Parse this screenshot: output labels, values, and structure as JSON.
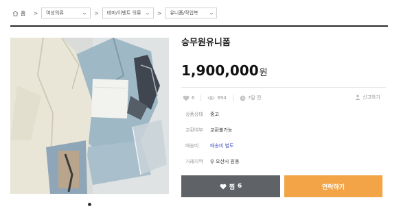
{
  "breadcrumb": {
    "home_label": "홈",
    "category1": "여성의류",
    "category2": "테마/이벤트 의류",
    "category3": "유니폼/작업복"
  },
  "product": {
    "title": "승무원유니폼",
    "price": "1,900,000",
    "currency": "원"
  },
  "stats": {
    "likes": "6",
    "views": "894",
    "time": "7달 전",
    "report_label": "신고하기"
  },
  "details": {
    "condition_label": "상품상태",
    "condition_value": "중고",
    "exchange_label": "교환여부",
    "exchange_value": "교환불가능",
    "shipping_label": "배송비",
    "shipping_value": "배송비 별도",
    "location_label": "거래지역",
    "location_value": "오산시 원동"
  },
  "actions": {
    "like_label": "찜",
    "like_count": "6",
    "contact_label": "연락하기"
  },
  "colors": {
    "contact_button": "#f2a446",
    "like_button": "#5f6368",
    "shipping_link": "#4a56c8"
  },
  "icons": [
    "home-icon",
    "chevron-down-icon",
    "heart-icon",
    "eye-icon",
    "clock-icon",
    "report-icon",
    "location-pin-icon"
  ]
}
